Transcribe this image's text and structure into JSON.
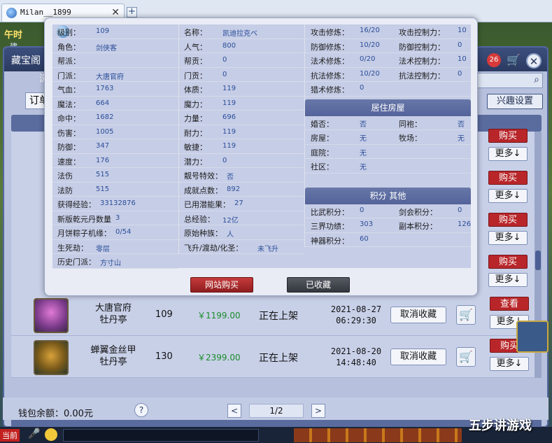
{
  "browser": {
    "tab_title": "Milan__1899",
    "close_glyph": "✕",
    "new_tab_glyph": "+"
  },
  "hud": {
    "time_label": "午时",
    "left_fragment": "建"
  },
  "shop": {
    "title": "藏宝阁",
    "sub_fragment": "浏",
    "cart_count": "26",
    "close_glyph": "✕",
    "order_button": "订单",
    "interest_button": "兴趣设置"
  },
  "rows": [
    {
      "name1": "大唐官府",
      "name2": "牡丹亭",
      "level": "109",
      "price": "￥1199.00",
      "status": "正在上架",
      "date": "2021-08-27",
      "time": "06:29:30",
      "cancel_label": "取消收藏",
      "top_action": "查看",
      "more_label": "更多↓"
    },
    {
      "name1": "蝉翼金丝甲",
      "name2": "牡丹亭",
      "level": "130",
      "price": "￥2399.00",
      "status": "正在上架",
      "date": "2021-08-20",
      "time": "14:48:40",
      "cancel_label": "取消收藏",
      "top_action": "购买",
      "more_label": "更多↓"
    }
  ],
  "side_buttons": {
    "buy": "购买",
    "more": "更多↓"
  },
  "footer": {
    "wallet": "钱包余额：0.00元",
    "help": "?",
    "prev": "<",
    "page": "1/2",
    "next": ">"
  },
  "taskbar": {
    "current_label": "当前"
  },
  "watermark": "五步讲游戏",
  "popup": {
    "col1": [
      {
        "label": "级别：",
        "value": "109"
      },
      {
        "label": "角色：",
        "value": "剑侠客"
      },
      {
        "label": "帮派：",
        "value": ""
      },
      {
        "label": "门派：",
        "value": "大唐官府"
      },
      {
        "label": "气血：",
        "value": "1763"
      },
      {
        "label": "魔法：",
        "value": "664"
      },
      {
        "label": "命中：",
        "value": "1682"
      },
      {
        "label": "伤害：",
        "value": "1005"
      },
      {
        "label": "防御：",
        "value": "347"
      },
      {
        "label": "速度：",
        "value": "176"
      },
      {
        "label": "法伤",
        "value": "515"
      },
      {
        "label": "法防",
        "value": "515"
      },
      {
        "label": "获得经验：",
        "value": "33132876"
      },
      {
        "label": "新版乾元丹数量",
        "value": "3"
      },
      {
        "label": "月饼粽子机缘：",
        "value": "0/54"
      },
      {
        "label": "生死劫：",
        "value": "零层"
      },
      {
        "label": "历史门派：",
        "value": "方寸山"
      }
    ],
    "col2": [
      {
        "label": "名称：",
        "value": "凯迪拉克ベ"
      },
      {
        "label": "人气：",
        "value": "800"
      },
      {
        "label": "帮贡：",
        "value": "0"
      },
      {
        "label": "门贡：",
        "value": "0"
      },
      {
        "label": "体质：",
        "value": "119"
      },
      {
        "label": "魔力：",
        "value": "119"
      },
      {
        "label": "力量：",
        "value": "696"
      },
      {
        "label": "耐力：",
        "value": "119"
      },
      {
        "label": "敏捷：",
        "value": "119"
      },
      {
        "label": "潜力：",
        "value": "0"
      },
      {
        "label": "靓号特效：",
        "value": "否"
      },
      {
        "label": "成就点数：",
        "value": "892"
      },
      {
        "label": "已用潜能果：",
        "value": "27"
      },
      {
        "label": "总经验：",
        "value": "12亿"
      },
      {
        "label": "原始种族：",
        "value": "人"
      },
      {
        "label": "飞升/渡劫/化圣：",
        "value": "未飞升"
      }
    ],
    "cultivation": [
      {
        "l1": "攻击修炼：",
        "v1": "16/20",
        "l2": "攻击控制力：",
        "v2": "10"
      },
      {
        "l1": "防御修炼：",
        "v1": "10/20",
        "l2": "防御控制力：",
        "v2": "0"
      },
      {
        "l1": "法术修炼：",
        "v1": "0/20",
        "l2": "法术控制力：",
        "v2": "10"
      },
      {
        "l1": "抗法修炼：",
        "v1": "10/20",
        "l2": "抗法控制力：",
        "v2": "0"
      },
      {
        "l1": "猎术修炼：",
        "v1": "0",
        "l2": "",
        "v2": ""
      }
    ],
    "housing_title": "居住房屋",
    "housing": [
      {
        "l1": "婚否：",
        "v1": "否",
        "l2": "同袍：",
        "v2": "否"
      },
      {
        "l1": "房屋：",
        "v1": "无",
        "l2": "牧场：",
        "v2": "无"
      },
      {
        "l1": "庭院：",
        "v1": "无",
        "l2": "",
        "v2": ""
      },
      {
        "l1": "社区：",
        "v1": "无",
        "l2": "",
        "v2": ""
      }
    ],
    "points_title": "积分 其他",
    "points": [
      {
        "l1": "比武积分：",
        "v1": "0",
        "l2": "剑会积分：",
        "v2": "0"
      },
      {
        "l1": "三界功绩：",
        "v1": "303",
        "l2": "副本积分：",
        "v2": "126"
      },
      {
        "l1": "神器积分：",
        "v1": "60",
        "l2": "",
        "v2": ""
      }
    ],
    "buy_web_label": "网站购买",
    "collected_label": "已收藏"
  },
  "colors": {
    "buy_red": "#b8262a",
    "price_green": "#1a8c2a",
    "header_blue": "#54639a"
  }
}
